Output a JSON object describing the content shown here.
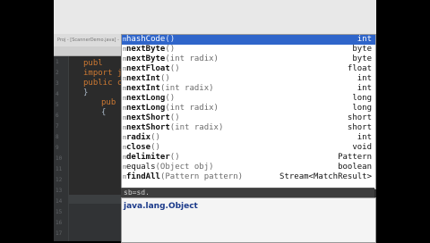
{
  "ide": {
    "title": "Proj - [ScannerDemo.java] - IntelliJ"
  },
  "gutter": {
    "line_numbers": [
      "1",
      "2",
      "3",
      "4",
      "5",
      "6",
      "7",
      "8",
      "9",
      "10",
      "11",
      "12",
      "13",
      "14",
      "15",
      "16",
      "17"
    ]
  },
  "code_lines": [
    {
      "text": "publ",
      "cls": "code"
    },
    {
      "text": "import j",
      "cls": "code"
    },
    {
      "text": "public c",
      "cls": "code"
    },
    {
      "text": "}",
      "cls": "brace"
    },
    {
      "text": "pub",
      "cls": "code"
    },
    {
      "text": "{",
      "cls": "brace"
    }
  ],
  "completion": {
    "items": [
      {
        "name": "hashCode",
        "params": "()",
        "return_type": "int",
        "selected": true
      },
      {
        "name": "nextByte",
        "params": "()",
        "return_type": "byte"
      },
      {
        "name": "nextByte",
        "params": "(int radix)",
        "return_type": "byte"
      },
      {
        "name": "nextFloat",
        "params": "()",
        "return_type": "float"
      },
      {
        "name": "nextInt",
        "params": "()",
        "return_type": "int"
      },
      {
        "name": "nextInt",
        "params": "(int radix)",
        "return_type": "int"
      },
      {
        "name": "nextLong",
        "params": "()",
        "return_type": "long"
      },
      {
        "name": "nextLong",
        "params": "(int radix)",
        "return_type": "long"
      },
      {
        "name": "nextShort",
        "params": "()",
        "return_type": "short"
      },
      {
        "name": "nextShort",
        "params": "(int radix)",
        "return_type": "short"
      },
      {
        "name": "radix",
        "params": "()",
        "return_type": "int"
      },
      {
        "name": "close",
        "params": "()",
        "return_type": "void"
      },
      {
        "name": "delimiter",
        "params": "()",
        "return_type": "Pattern"
      },
      {
        "name": "equals",
        "params": "(Object obj)",
        "return_type": "boolean"
      },
      {
        "name": "findAll",
        "params": "(Pattern pattern)",
        "return_type": "Stream<MatchResult>"
      }
    ]
  },
  "editor_input": "sb=sd.",
  "javadoc": {
    "title": "java.lang.Object"
  },
  "colors": {
    "selection": "#2f65ca",
    "editor_bg": "#2b2b2b",
    "keyword": "#cc7832"
  }
}
